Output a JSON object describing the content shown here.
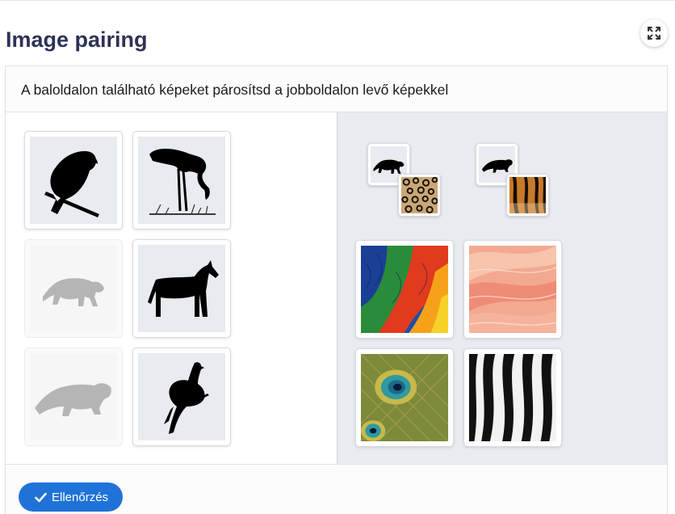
{
  "page": {
    "title": "Image pairing",
    "fullscreen_icon": "expand-icon"
  },
  "task": {
    "instruction": "A baloldalon található képeket párosítsd a jobboldalon levő képekkel"
  },
  "left_cards": [
    {
      "name": "parrot",
      "icon": "parrot-silhouette",
      "state": "available"
    },
    {
      "name": "flamingo",
      "icon": "flamingo-silhouette",
      "state": "available"
    },
    {
      "name": "jaguar",
      "icon": "jaguar-silhouette",
      "state": "used"
    },
    {
      "name": "zebra",
      "icon": "zebra-silhouette",
      "state": "available"
    },
    {
      "name": "tiger",
      "icon": "tiger-silhouette",
      "state": "used"
    },
    {
      "name": "peacock",
      "icon": "peacock-silhouette",
      "state": "available"
    }
  ],
  "right_targets": [
    {
      "name": "leopard-fur",
      "paired_with": "jaguar",
      "texture": "leopard-spots"
    },
    {
      "name": "tiger-fur",
      "paired_with": "tiger",
      "texture": "tiger-stripes"
    },
    {
      "name": "parrot-feathers",
      "paired_with": null,
      "texture": "macaw-feathers"
    },
    {
      "name": "flamingo-feathers",
      "paired_with": null,
      "texture": "pink-feathers"
    },
    {
      "name": "peacock-feathers",
      "paired_with": null,
      "texture": "peacock-eye"
    },
    {
      "name": "zebra-stripes",
      "paired_with": null,
      "texture": "zebra-stripes"
    }
  ],
  "footer": {
    "check_label": "Ellenőrzés"
  },
  "colors": {
    "title": "#2e3256",
    "accent": "#1f73d8",
    "right_area_bg": "#e8ebef"
  }
}
